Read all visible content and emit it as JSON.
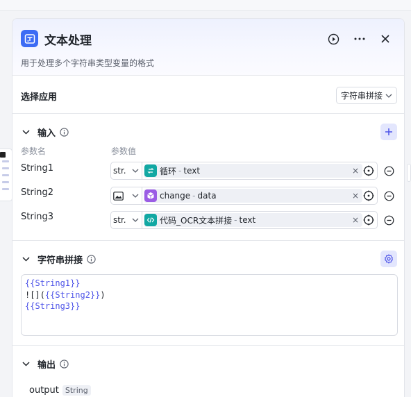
{
  "header": {
    "title": "文本处理",
    "description": "用于处理多个字符串类型变量的格式"
  },
  "app": {
    "label": "选择应用",
    "value": "字符串拼接"
  },
  "inputs": {
    "title": "输入",
    "col_name": "参数名",
    "col_value": "参数值",
    "rows": [
      {
        "name": "String1",
        "type": "str.",
        "source": "循环",
        "sep": "-",
        "field": "text",
        "icon": "loop-icon",
        "color": "#12a8a3"
      },
      {
        "name": "String2",
        "type": "",
        "source": "change",
        "sep": "-",
        "field": "data",
        "icon": "cube-icon",
        "color": "#9b5de5"
      },
      {
        "name": "String3",
        "type": "str.",
        "source": "代码_OCR文本拼接",
        "sep": "-",
        "field": "text",
        "icon": "code-icon",
        "color": "#12a8a3"
      }
    ]
  },
  "concat": {
    "title": "字符串拼接",
    "line1": "{{String1}}",
    "line2_prefix": "![](",
    "line2_var": "{{String2}}",
    "line2_suffix": ")",
    "line3": "{{String3}}"
  },
  "output": {
    "title": "输出",
    "name": "output",
    "type": "String"
  }
}
